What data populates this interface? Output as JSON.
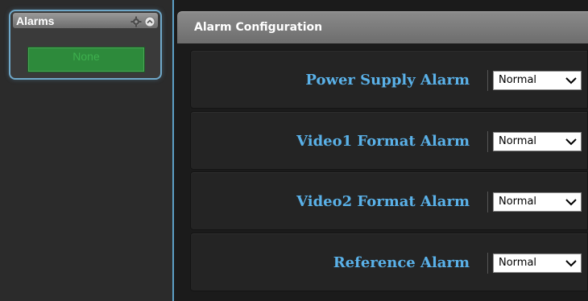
{
  "sidebar": {
    "widget": {
      "title": "Alarms",
      "status": "None",
      "icons": [
        "gear-icon",
        "collapse-icon"
      ]
    }
  },
  "main": {
    "header": {
      "title": "Alarm Configuration"
    },
    "rows": [
      {
        "label": "Power Supply Alarm",
        "value": "Normal"
      },
      {
        "label": "Video1 Format Alarm",
        "value": "Normal"
      },
      {
        "label": "Video2 Format Alarm",
        "value": "Normal"
      },
      {
        "label": "Reference Alarm",
        "value": "Normal"
      }
    ]
  },
  "colors": {
    "accent": "#5ab1e8",
    "status_ok": "#2d8a3b",
    "border_accent": "#6fa8c9"
  }
}
